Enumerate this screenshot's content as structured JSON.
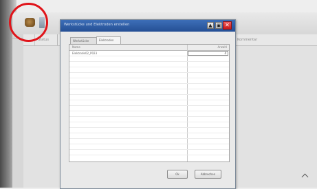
{
  "dialog": {
    "title": "Werkstücke und Elektroden erstellen",
    "title_buttons": {
      "up": "▲",
      "restore": "▣",
      "close": "✕"
    },
    "tabs": [
      {
        "label": "Werkstücke"
      },
      {
        "label": "Elektroden",
        "active": true
      }
    ],
    "table": {
      "columns": [
        "Name",
        "Anzahl"
      ],
      "rows": [
        {
          "name": "Elektrode02_P023",
          "qty": "4"
        }
      ]
    },
    "buttons": {
      "ok": "Ok",
      "cancel": "Abbrechen"
    }
  },
  "background": {
    "column_left_label": "Status",
    "column_right_label": "Kommentar"
  },
  "colors": {
    "titlebar": "#2c5aa0",
    "close_button": "#d62a2a",
    "highlight_ring": "#e0141a"
  },
  "icons": [
    "app-icon",
    "toolbar-icon"
  ]
}
